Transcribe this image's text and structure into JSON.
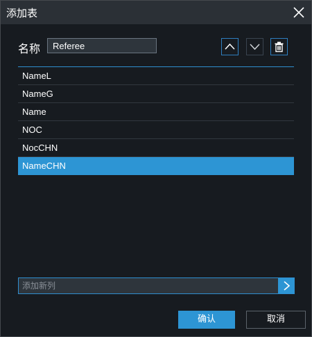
{
  "dialog": {
    "title": "添加表",
    "name_label": "名称",
    "name_value": "Referee",
    "columns": [
      "NameL",
      "NameG",
      "Name",
      "NOC",
      "NocCHN",
      "NameCHN"
    ],
    "selected_column": "NameCHN",
    "add_column_placeholder": "添加新列",
    "confirm_label": "确认",
    "cancel_label": "取消"
  },
  "icons": {
    "close": "close-icon",
    "move_up": "chevron-up-icon",
    "move_down": "chevron-down-icon",
    "delete": "trash-icon",
    "add": "chevron-right-icon"
  },
  "colors": {
    "accent": "#2d95d4",
    "background": "#171b20",
    "titlebar": "#2b3036"
  }
}
